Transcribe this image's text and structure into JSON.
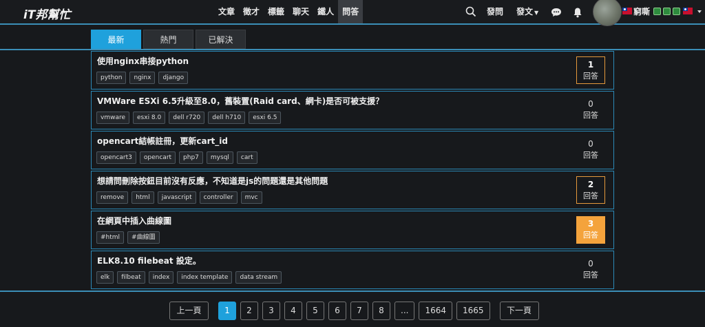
{
  "brand": {
    "logo_text": "iT邦幫忙"
  },
  "nav": {
    "links": [
      {
        "label": "文章",
        "active": false
      },
      {
        "label": "徵才",
        "active": false
      },
      {
        "label": "標籤",
        "active": false
      },
      {
        "label": "聊天",
        "active": false
      },
      {
        "label": "鐵人",
        "active": false
      },
      {
        "label": "問答",
        "active": true
      }
    ],
    "ask_label": "發問",
    "post_label": "發文",
    "username": "窮嘶",
    "icons": [
      "search-icon",
      "chat-icon",
      "bell-icon"
    ]
  },
  "tabs": [
    {
      "label": "最新",
      "active": true
    },
    {
      "label": "熱門",
      "active": false
    },
    {
      "label": "已解決",
      "active": false
    }
  ],
  "questions": [
    {
      "title": "使用nginx串接python",
      "tags": [
        "python",
        "nginx",
        "django"
      ],
      "answers": "1",
      "answers_label": "回答",
      "style": "bordered"
    },
    {
      "title": "VMWare ESXi 6.5升級至8.0，舊裝置(Raid card、網卡)是否可被支援？",
      "tags": [
        "vmware",
        "esxi 8.0",
        "dell r720",
        "dell h710",
        "esxi 6.5"
      ],
      "answers": "0",
      "answers_label": "回答",
      "style": "plain"
    },
    {
      "title": "opencart結帳註冊，更新cart_id",
      "tags": [
        "opencart3",
        "opencart",
        "php7",
        "mysql",
        "cart"
      ],
      "answers": "0",
      "answers_label": "回答",
      "style": "plain"
    },
    {
      "title": "想請問刪除按鈕目前沒有反應，不知道是js的問題還是其他問題",
      "tags": [
        "remove",
        "html",
        "javascript",
        "controller",
        "mvc"
      ],
      "answers": "2",
      "answers_label": "回答",
      "style": "bordered"
    },
    {
      "title": "在網頁中插入曲線圖",
      "tags": [
        "#html",
        "#曲線圖"
      ],
      "answers": "3",
      "answers_label": "回答",
      "style": "filled"
    },
    {
      "title": "ELK8.10 filebeat 設定。",
      "tags": [
        "elk",
        "filbeat",
        "index",
        "index template",
        "data stream"
      ],
      "answers": "0",
      "answers_label": "回答",
      "style": "plain"
    }
  ],
  "pagination": {
    "prev_label": "上一頁",
    "pages": [
      "1",
      "2",
      "3",
      "4",
      "5",
      "6",
      "7",
      "8",
      "...",
      "1664",
      "1665"
    ],
    "current": "1",
    "next_label": "下一頁"
  },
  "colors": {
    "accent": "#1fa1dc",
    "answer_orange": "#f4a33c",
    "border_blue": "#2b8ab8",
    "background": "#17191c"
  }
}
